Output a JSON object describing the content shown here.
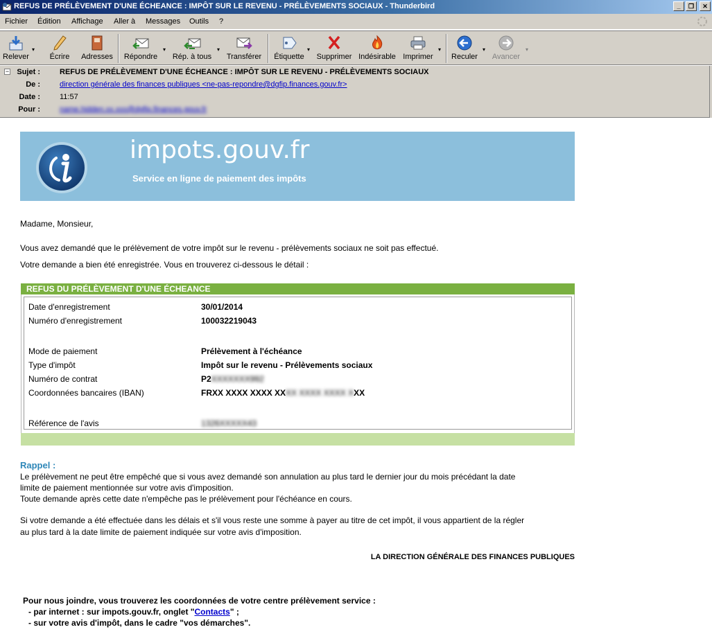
{
  "window": {
    "title": "REFUS DE PRÉLÈVEMENT D'UNE ÉCHEANCE : IMPÔT SUR LE REVENU - PRÉLÈVEMENTS SOCIAUX - Thunderbird",
    "buttons": {
      "minimize": "_",
      "maximize": "❐",
      "close": "✕"
    }
  },
  "menu": [
    "Fichier",
    "Édition",
    "Affichage",
    "Aller à",
    "Messages",
    "Outils",
    "?"
  ],
  "toolbar": {
    "relever": "Relever",
    "ecrire": "Écrire",
    "adresses": "Adresses",
    "repondre": "Répondre",
    "rep_tous": "Rép. à tous",
    "transferer": "Transférer",
    "etiquette": "Étiquette",
    "supprimer": "Supprimer",
    "indesirable": "Indésirable",
    "imprimer": "Imprimer",
    "reculer": "Reculer",
    "avancer": "Avancer",
    "dropdown_glyph": "▾"
  },
  "header": {
    "subject_label": "Sujet :",
    "subject": "REFUS DE PRÉLÈVEMENT D'UNE ÉCHEANCE : IMPÔT SUR LE REVENU - PRÉLÈVEMENTS SOCIAUX",
    "from_label": "De :",
    "from": "direction générale des finances publiques <ne-pas-repondre@dgfip.finances.gouv.fr>",
    "date_label": "Date :",
    "date": "11:57",
    "to_label": "Pour :",
    "to": "name.hidden.xx.xxx@dgfip.finances.gouv.fr",
    "collapse_glyph": "−"
  },
  "banner": {
    "brand": "impots.gouv.fr",
    "tagline": "Service en ligne de paiement des impôts"
  },
  "body": {
    "greeting": "Madame, Monsieur,",
    "p1": "Vous avez demandé que le prélèvement de votre impôt sur le revenu - prélèvements sociaux ne soit pas effectué.",
    "p2": "Votre demande a bien été enregistrée. Vous en trouverez ci-dessous le détail :",
    "box_title": "REFUS DU PRÉLÈVEMENT D'UNE ÉCHEANCE",
    "fields": [
      {
        "label": "Date d'enregistrement",
        "value": "30/01/2014"
      },
      {
        "label": "Numéro d'enregistrement",
        "value": "100032219043"
      },
      {
        "label": "Mode de paiement",
        "value": "Prélèvement à l'échéance"
      },
      {
        "label": "Type d'impôt",
        "value": "Impôt sur le revenu - Prélèvements sociaux"
      },
      {
        "label": "Numéro de contrat",
        "value_prefix": "P2",
        "value_hidden": "XXXXXXX992"
      },
      {
        "label": "Coordonnées bancaires (IBAN)",
        "value_prefix": "FRXX XXXX XXXX XX",
        "value_hidden": "XX XXXX XXXX X",
        "value_suffix": "XX"
      },
      {
        "label": "Référence de l'avis",
        "value_hidden": "1326XXXXX43"
      }
    ],
    "rappel_title": "Rappel :",
    "rappel_1": "Le prélèvement ne peut être empêché que si vous avez demandé son annulation au plus tard le dernier jour du mois précédant la date",
    "rappel_2": "limite de paiement mentionnée sur votre avis d'imposition.",
    "rappel_3": "Toute demande après cette date n'empêche pas le prélèvement pour l'échéance en cours.",
    "rappel_4": "Si votre demande a été effectuée dans les délais et s'il vous reste une somme à payer au titre de cet impôt, il vous appartient de la régler",
    "rappel_5": "au plus tard à la date limite de paiement indiquée sur votre avis d'imposition.",
    "signature": "LA DIRECTION GÉNÉRALE DES FINANCES PUBLIQUES",
    "contact_intro": "Pour nous joindre, vous trouverez les coordonnées de votre centre prélèvement service :",
    "contact_line1_pre": "- par internet : sur impots.gouv.fr, onglet \"",
    "contact_link": "Contacts",
    "contact_line1_post": "\" ;",
    "contact_line2": "- sur votre avis d'impôt, dans le cadre \"vos démarches\"."
  }
}
